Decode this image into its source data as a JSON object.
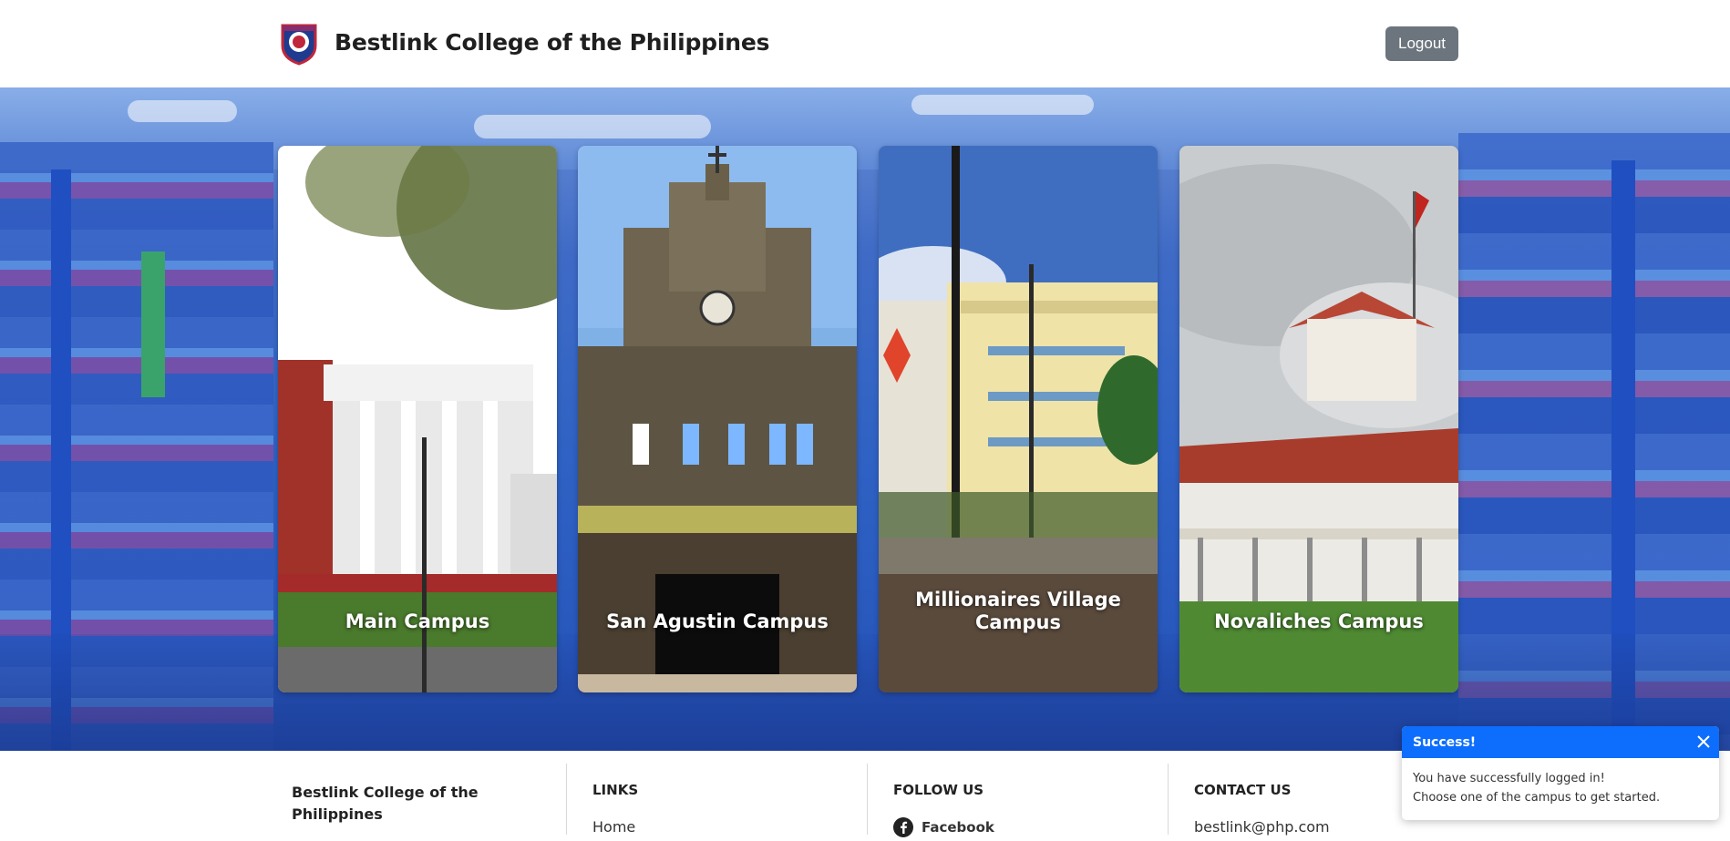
{
  "header": {
    "title": "Bestlink College of the Philippines",
    "logout_label": "Logout"
  },
  "campuses": [
    {
      "name": "Main Campus"
    },
    {
      "name": "San Agustin Campus"
    },
    {
      "name": "Millionaires Village Campus"
    },
    {
      "name": "Novaliches Campus"
    }
  ],
  "footer": {
    "about_title": "Bestlink College of the Philippines",
    "links_title": "LINKS",
    "links": [
      "Home"
    ],
    "follow_title": "FOLLOW US",
    "social": [
      {
        "label": "Facebook",
        "icon": "facebook-icon"
      }
    ],
    "contact_title": "CONTACT US",
    "email": "bestlink@php.com"
  },
  "toast": {
    "title": "Success!",
    "line1": "You have successfully logged in!",
    "line2": "Choose one of the campus to get started."
  },
  "colors": {
    "primary": "#0d6efd",
    "logout_bg": "#6c757d"
  }
}
